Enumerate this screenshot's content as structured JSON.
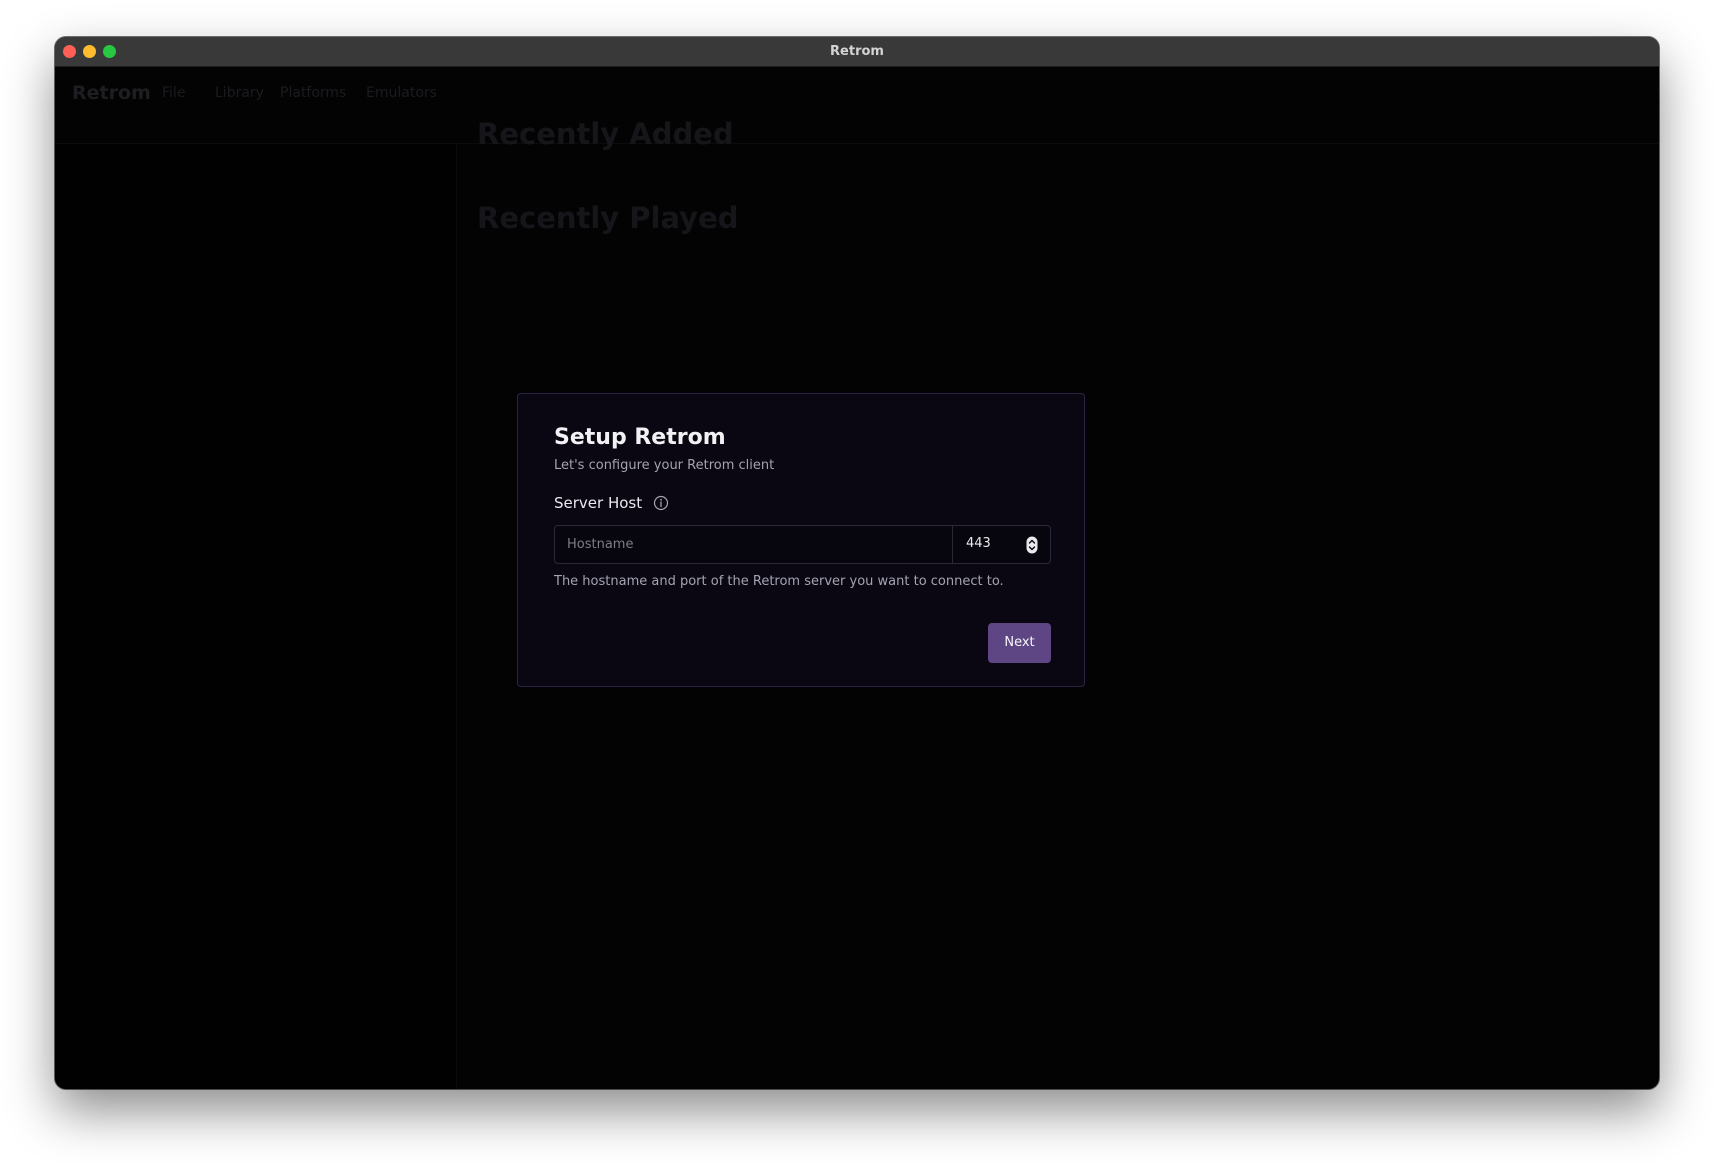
{
  "window": {
    "title": "Retrom"
  },
  "menubar": {
    "brand": "Retrom",
    "items": [
      {
        "label": "File"
      },
      {
        "label": "Library"
      },
      {
        "label": "Platforms"
      },
      {
        "label": "Emulators"
      }
    ]
  },
  "main": {
    "sections": [
      {
        "title": "Recently Added"
      },
      {
        "title": "Recently Played"
      }
    ]
  },
  "dialog": {
    "title": "Setup Retrom",
    "subtitle": "Let's configure your Retrom client",
    "server_host": {
      "label": "Server Host",
      "hostname_placeholder": "Hostname",
      "hostname_value": "",
      "port_value": "443",
      "helper": "The hostname and port of the Retrom server you want to connect to."
    },
    "next_label": "Next"
  },
  "colors": {
    "accent": "#5e4685",
    "dialog_bg": "#0a0713",
    "app_bg": "#050507"
  },
  "icons": {
    "info": "info-circle-icon",
    "stepper": "up-down-chevron-icon"
  }
}
